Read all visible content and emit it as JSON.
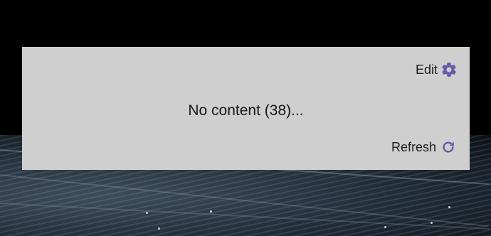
{
  "widget": {
    "message": "No content (38)...",
    "edit_label": "Edit",
    "refresh_label": "Refresh",
    "edit_icon": "gear-icon",
    "refresh_icon": "refresh-icon"
  },
  "colors": {
    "panel_background": "#cfcfcf",
    "accent": "#6b5aa8",
    "page_background": "#000000"
  }
}
